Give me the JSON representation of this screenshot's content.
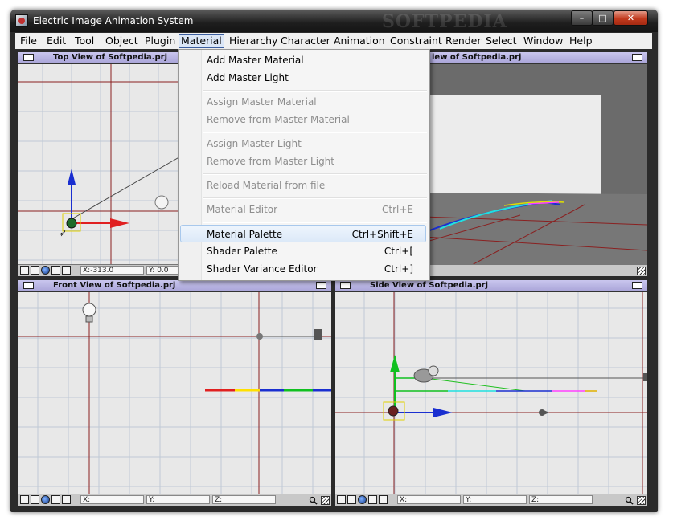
{
  "window": {
    "title": "Electric Image Animation System",
    "watermark": "SOFTPEDIA",
    "controls": {
      "minimize": "–",
      "maximize": "□",
      "close": "✕"
    }
  },
  "menubar": {
    "items": [
      "File",
      "Edit",
      "Tool",
      "Object",
      "Plugin",
      "Material",
      "Hierarchy",
      "Character",
      "Animation",
      "Constraint",
      "Render",
      "Select",
      "Window",
      "Help"
    ],
    "active": "Material"
  },
  "material_menu": {
    "items": [
      {
        "label": "Add Master Material",
        "shortcut": "",
        "enabled": true
      },
      {
        "label": "Add Master Light",
        "shortcut": "",
        "enabled": true
      },
      {
        "label": "Assign Master Material",
        "shortcut": "",
        "enabled": false
      },
      {
        "label": "Remove from Master Material",
        "shortcut": "",
        "enabled": false
      },
      {
        "label": "Assign Master Light",
        "shortcut": "",
        "enabled": false
      },
      {
        "label": "Remove from Master Light",
        "shortcut": "",
        "enabled": false
      },
      {
        "label": "Reload Material from file",
        "shortcut": "",
        "enabled": false
      },
      {
        "label": "Material Editor",
        "shortcut": "Ctrl+E",
        "enabled": false
      },
      {
        "label": "Material Palette",
        "shortcut": "Ctrl+Shift+E",
        "enabled": true,
        "highlighted": true
      },
      {
        "label": "Shader Palette",
        "shortcut": "Ctrl+[",
        "enabled": true
      },
      {
        "label": "Shader Variance Editor",
        "shortcut": "Ctrl+]",
        "enabled": true
      }
    ]
  },
  "viewports": {
    "top": {
      "title": "Top View of Softpedia.prj",
      "x": "X:-313.0",
      "y": "Y: 0.0",
      "watermark": "SOFTPEDIA",
      "watermark_url": "www.softpedia.com"
    },
    "camera": {
      "title": "iew of Softpedia.prj"
    },
    "front": {
      "title": "Front View of Softpedia.prj",
      "x": "X:",
      "y": "Y:",
      "z": "Z:"
    },
    "side": {
      "title": "Side View of Softpedia.prj",
      "x": "X:",
      "y": "Y:",
      "z": "Z:"
    }
  },
  "colors": {
    "viewport_title": "#b3aee0",
    "grid_bg": "#e8e8e8",
    "grid_line": "#8a2020",
    "axis_blue": "#1a2fd0",
    "axis_red": "#e02020",
    "axis_green": "#10c020"
  },
  "icons": [
    "app-icon",
    "viewport-window-icon",
    "axis-icon",
    "grid-icon",
    "globe-icon",
    "camera-icon",
    "render-icon",
    "magnify-icon",
    "resize-grip-icon"
  ]
}
